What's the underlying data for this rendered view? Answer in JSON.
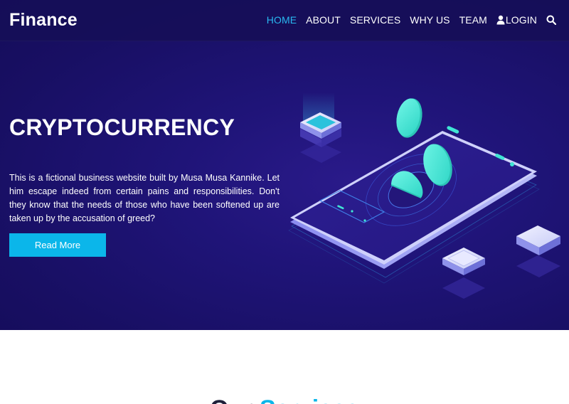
{
  "brand": {
    "name": "Finance"
  },
  "nav": {
    "items": [
      {
        "label": "HOME",
        "active": true
      },
      {
        "label": "ABOUT",
        "active": false
      },
      {
        "label": "SERVICES",
        "active": false
      },
      {
        "label": "WHY US",
        "active": false
      },
      {
        "label": "TEAM",
        "active": false
      },
      {
        "label": "LOGIN",
        "active": false,
        "icon": "user-icon"
      }
    ],
    "search_icon": "search-icon"
  },
  "hero": {
    "title": "CRYPTOCURRENCY",
    "text": "This is a fictional business website built by Musa Musa Kannike. Let him escape indeed from certain pains and responsibilities. Don't they know that the needs of those who have been softened up are taken up by the accusation of greed?",
    "button_label": "Read More"
  },
  "section": {
    "title_part1": "Our ",
    "title_part2": "Services"
  },
  "colors": {
    "hero_bg": "#1a1066",
    "accent": "#0bb6ea",
    "active_nav": "#29b8f0",
    "coin": "#40e6d4"
  }
}
